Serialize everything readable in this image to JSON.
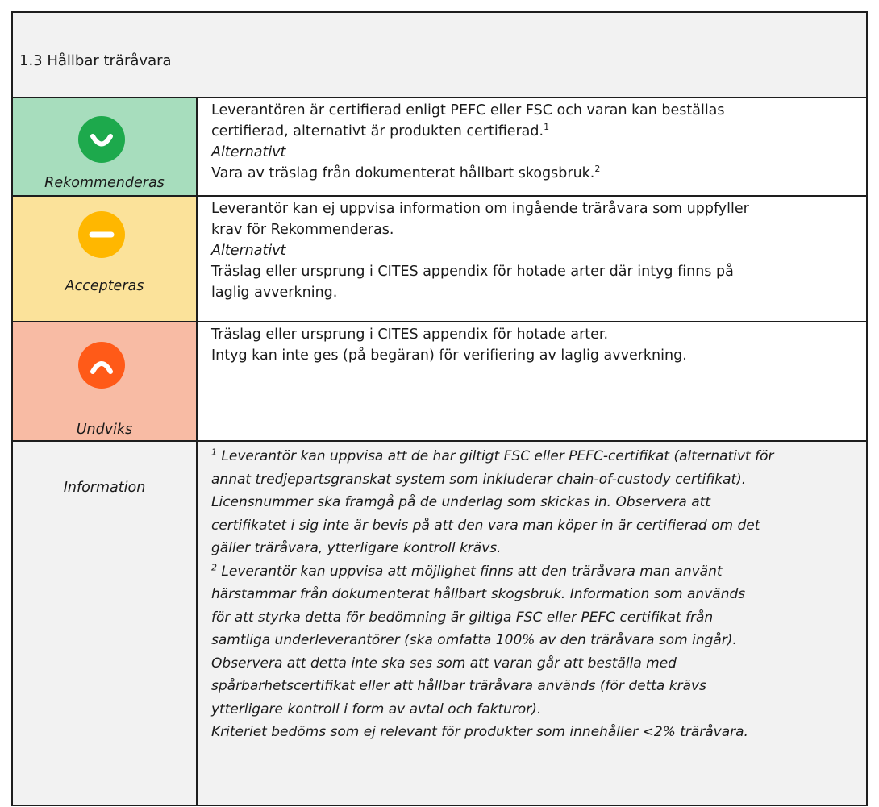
{
  "header": {
    "title": "1.3 Hållbar träråvara"
  },
  "colors": {
    "recommend_bg": "#a7ddbd",
    "recommend_icon": "#1da94c",
    "accept_bg": "#fbe29a",
    "accept_icon": "#ffb700",
    "avoid_bg": "#f8bba4",
    "avoid_icon": "#ff5a18",
    "header_bg": "#f2f2f2",
    "border": "#1e1e1e"
  },
  "rows": {
    "recommend": {
      "icon": "smile-icon",
      "label": "Rekommenderas",
      "line1": "Leverantören är certifierad enligt PEFC eller FSC och varan kan beställas",
      "line2": "certifierad, alternativt är produkten certifierad.",
      "line2_sup": "1",
      "line3": "Alternativt",
      "line4": "Vara av träslag från dokumenterat hållbart skogsbruk.",
      "line4_sup": "2"
    },
    "accept": {
      "icon": "neutral-icon",
      "label": "Accepteras",
      "line1": "Leverantör kan ej uppvisa information om ingående träråvara som uppfyller",
      "line2": "krav för Rekommenderas.",
      "line3": "Alternativt",
      "line4": "Träslag eller ursprung i CITES appendix för hotade arter där intyg finns på",
      "line5": "laglig avverkning."
    },
    "avoid": {
      "icon": "frown-icon",
      "label": "Undviks",
      "line1": "Träslag eller ursprung i CITES appendix för hotade arter.",
      "line2": "Intyg kan inte ges (på begäran) för verifiering av laglig avverkning."
    },
    "info": {
      "label": "Information",
      "sup1": "1",
      "l1": "Leverantör kan uppvisa att de har giltigt FSC eller PEFC-certifikat (alternativt för",
      "l2": "annat tredjepartsgranskat system som inkluderar chain-of-custody certifikat).",
      "l3": "Licensnummer ska framgå på de underlag som skickas in. Observera att",
      "l4": "certifikatet i sig inte är bevis på att den vara man köper in är certifierad om det",
      "l5": "gäller träråvara, ytterligare kontroll krävs.",
      "sup2": "2",
      "l6": "Leverantör kan uppvisa att möjlighet finns att den träråvara man använt",
      "l7": "härstammar från dokumenterat hållbart skogsbruk. Information som används",
      "l8": "för att styrka detta för bedömning är giltiga FSC eller PEFC certifikat från",
      "l9": "samtliga underleverantörer (ska omfatta 100% av den träråvara som ingår).",
      "l10": "Observera att detta inte ska ses som att varan går att beställa med",
      "l11": "spårbarhetscertifikat eller att hållbar träråvara används (för detta krävs",
      "l12": "ytterligare kontroll i form av avtal och fakturor).",
      "l13": "Kriteriet bedöms som ej relevant för produkter som innehåller <2% träråvara."
    }
  }
}
